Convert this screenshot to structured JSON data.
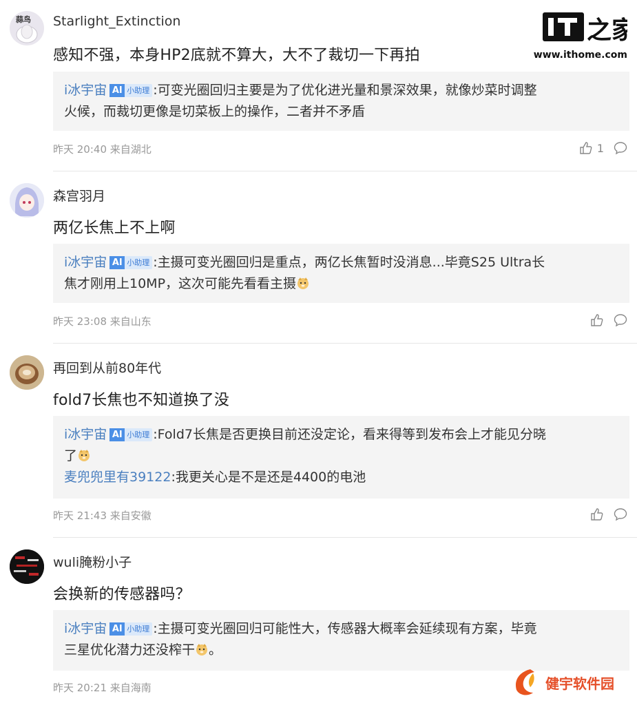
{
  "logo": {
    "site": "www.ithome.com",
    "colors": {
      "brand": "#111111"
    }
  },
  "reply_badge": {
    "label": "小助理",
    "ai": "AI"
  },
  "comments": [
    {
      "username": "Starlight_Extinction",
      "text": "感知不强，本身HP2底就不算大，大不了裁切一下再拍",
      "replies": [
        {
          "name": "i冰宇宙",
          "line1": ":可变光圈回归主要是为了优化进光量和景深效果，就像炒菜时调整",
          "line2": "火候，而裁切更像是切菜板上的操作，二者并不矛盾"
        }
      ],
      "time": "昨天 20:40 来自湖北",
      "likes": "1"
    },
    {
      "username": "森宫羽月",
      "text": "两亿长焦上不上啊",
      "replies": [
        {
          "name": "i冰宇宙",
          "line1": ":主摄可变光圈回归是重点，两亿长焦暂时没消息...毕竟S25 Ultra长",
          "line2": "焦才刚用上10MP，这次可能先看看主摄"
        }
      ],
      "time": "昨天 23:08 来自山东",
      "likes": ""
    },
    {
      "username": "再回到从前80年代",
      "text": "fold7长焦也不知道换了没",
      "replies": [
        {
          "name": "i冰宇宙",
          "line1": ":Fold7长焦是否更换目前还没定论，看来得等到发布会上才能见分晓",
          "line2": "了"
        },
        {
          "name": "麦兜兜里有39122",
          "line1": ":我更关心是不是还是4400的电池"
        }
      ],
      "time": "昨天 21:43 来自安徽",
      "likes": ""
    },
    {
      "username": "wuli腌粉小子",
      "text": "会换新的传感器吗？",
      "replies": [
        {
          "name": "i冰宇宙",
          "line1": ":主摄可变光圈回归可能性大，传感器大概率会延续现有方案，毕竟",
          "line2": "三星优化潜力还没榨干",
          "line2_tail": "。"
        }
      ],
      "time": "昨天 20:21 来自海南",
      "likes": ""
    }
  ],
  "avatars": {
    "c0": "蒜鸟"
  },
  "watermark": {
    "text": "健宇软件园"
  }
}
